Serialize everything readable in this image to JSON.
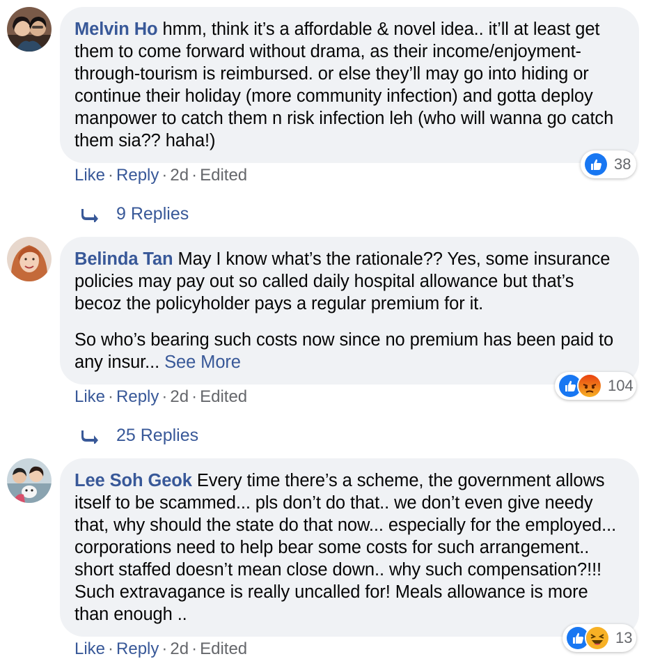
{
  "comments": [
    {
      "author": "Melvin Ho",
      "paragraphs": [
        "hmm, think it’s a affordable & novel idea.. it’ll at least get them to come forward without drama, as their income/enjoyment-through-tourism is reimbursed. or else they’ll may go into hiding or continue their holiday (more community infection) and gotta deploy manpower to catch them n risk infection leh (who will wanna go catch them sia?? haha!)"
      ],
      "actions": {
        "like": "Like",
        "reply": "Reply",
        "time": "2d",
        "edited": "Edited"
      },
      "reactions": {
        "icons": [
          "like-icon"
        ],
        "count": "38"
      },
      "replies": "9 Replies"
    },
    {
      "author": "Belinda Tan",
      "paragraphs": [
        "May I know what’s the rationale?? Yes, some insurance policies may pay out so called daily hospital allowance but that’s becoz the policyholder pays a regular premium for it.",
        "So who’s bearing such costs now since no premium has been paid to any insur..."
      ],
      "see_more": "See More",
      "actions": {
        "like": "Like",
        "reply": "Reply",
        "time": "2d",
        "edited": "Edited"
      },
      "reactions": {
        "icons": [
          "like-icon",
          "angry-icon"
        ],
        "count": "104"
      },
      "replies": "25 Replies"
    },
    {
      "author": "Lee Soh Geok",
      "paragraphs": [
        "Every time there’s a scheme, the government allows itself to be scammed... pls don’t do that.. we don’t even give needy that, why should the state do that now... especially for the employed... corporations need to help bear some costs for such arrangement.. short staffed doesn’t mean close down.. why such compensation?!!! Such extravagance is really uncalled for! Meals allowance is more than enough .."
      ],
      "actions": {
        "like": "Like",
        "reply": "Reply",
        "time": "2d",
        "edited": "Edited"
      },
      "reactions": {
        "icons": [
          "like-icon",
          "haha-icon"
        ],
        "count": "13"
      }
    }
  ],
  "colors": {
    "author": "#385898",
    "bubble": "#f0f2f5",
    "meta": "#65676b",
    "like_blue": "#1877f2",
    "angry_orange": "#e9710f",
    "haha_yellow": "#f7b125"
  }
}
